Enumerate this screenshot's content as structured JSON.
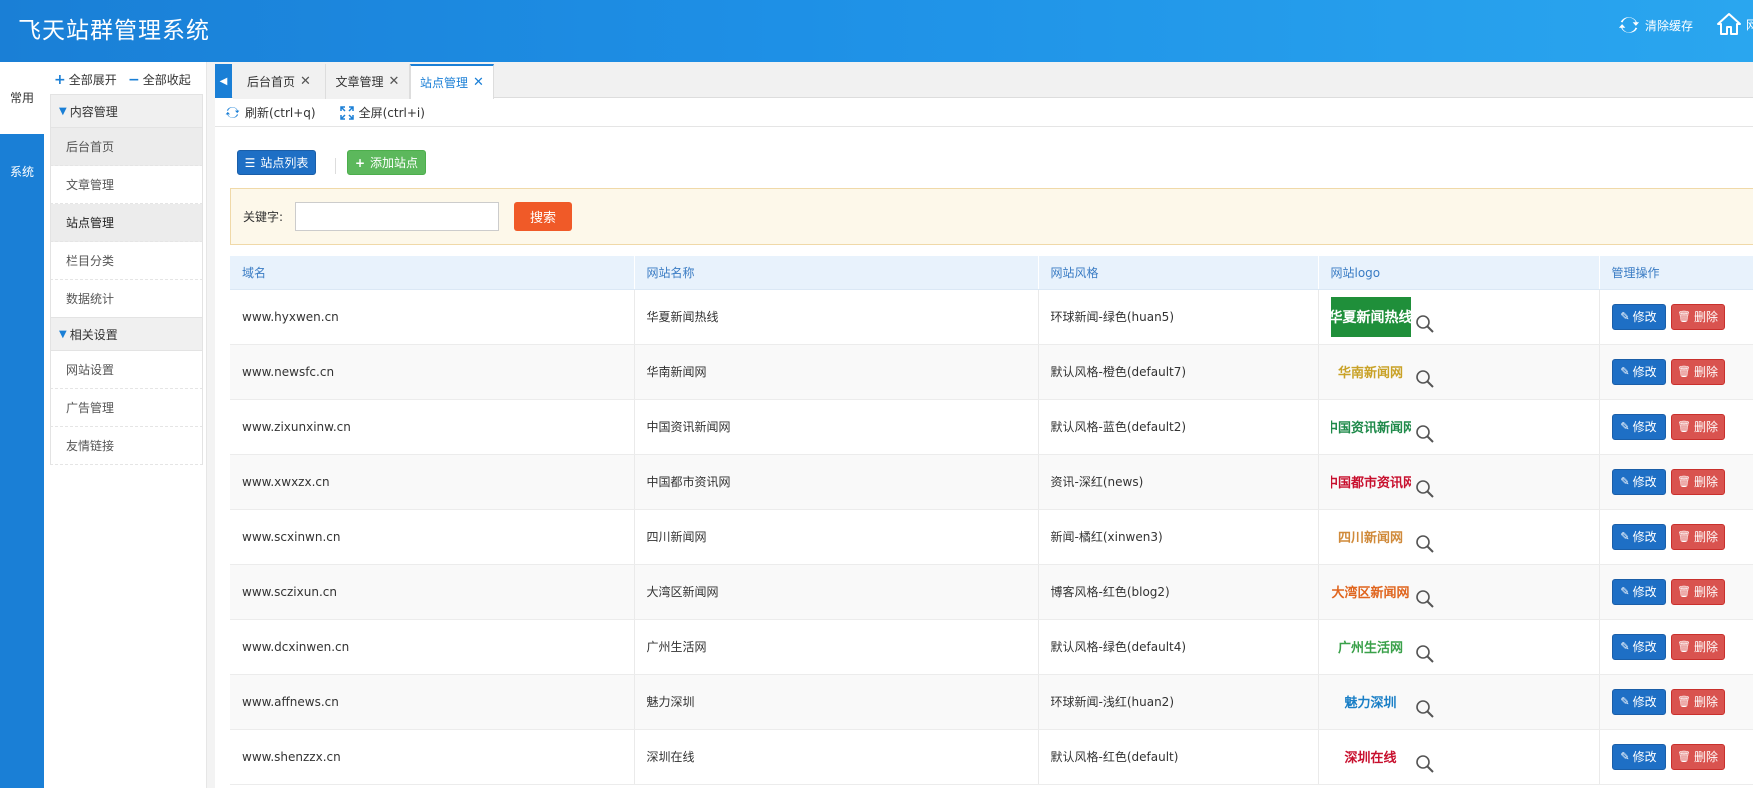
{
  "header": {
    "title": "飞天站群管理系统",
    "clear_cache": "清除缓存",
    "home_partial": "网"
  },
  "rail": {
    "tabs": [
      "常用",
      "系统"
    ]
  },
  "sidebar": {
    "expand_all": "全部展开",
    "collapse_all": "全部收起",
    "groups": [
      {
        "title": "内容管理",
        "items": [
          "后台首页",
          "文章管理",
          "站点管理",
          "栏目分类",
          "数据统计"
        ]
      },
      {
        "title": "相关设置",
        "items": [
          "网站设置",
          "广告管理",
          "友情链接"
        ]
      }
    ]
  },
  "tabs": [
    {
      "label": "后台首页"
    },
    {
      "label": "文章管理"
    },
    {
      "label": "站点管理"
    }
  ],
  "toolbar": {
    "refresh": "刷新(ctrl+q)",
    "fullscreen": "全屏(ctrl+i)"
  },
  "actions": {
    "site_list": "站点列表",
    "add_site": "添加站点"
  },
  "search": {
    "label": "关键字:",
    "value": "",
    "placeholder": "",
    "button": "搜索"
  },
  "table": {
    "columns": [
      "域名",
      "网站名称",
      "网站风格",
      "网站logo",
      "管理操作"
    ],
    "edit_label": "修改",
    "delete_label": "删除",
    "rows": [
      {
        "domain": "www.hyxwen.cn",
        "name": "华夏新闻热线",
        "style": "环球新闻-绿色(huan5)",
        "logo_text": "华夏新闻热线",
        "logo_color": "#ffffff"
      },
      {
        "domain": "www.newsfc.cn",
        "name": "华南新闻网",
        "style": "默认风格-橙色(default7)",
        "logo_text": "华南新闻网",
        "logo_color": "#c9a227"
      },
      {
        "domain": "www.zixunxinw.cn",
        "name": "中国资讯新闻网",
        "style": "默认风格-蓝色(default2)",
        "logo_text": "中国资讯新闻网",
        "logo_color": "#1f8a4a"
      },
      {
        "domain": "www.xwxzx.cn",
        "name": "中国都市资讯网",
        "style": "资讯-深红(news)",
        "logo_text": "中国都市资讯网",
        "logo_color": "#c8102e"
      },
      {
        "domain": "www.scxinwn.cn",
        "name": "四川新闻网",
        "style": "新闻-橘红(xinwen3)",
        "logo_text": "四川新闻网",
        "logo_color": "#d08a3a"
      },
      {
        "domain": "www.sczixun.cn",
        "name": "大湾区新闻网",
        "style": "博客风格-红色(blog2)",
        "logo_text": "大湾区新闻网",
        "logo_color": "#e0651e"
      },
      {
        "domain": "www.dcxinwen.cn",
        "name": "广州生活网",
        "style": "默认风格-绿色(default4)",
        "logo_text": "广州生活网",
        "logo_color": "#3aa14a"
      },
      {
        "domain": "www.affnews.cn",
        "name": "魅力深圳",
        "style": "环球新闻-浅红(huan2)",
        "logo_text": "魅力深圳",
        "logo_color": "#1a7fc6"
      },
      {
        "domain": "www.shenzzx.cn",
        "name": "深圳在线",
        "style": "默认风格-红色(default)",
        "logo_text": "深圳在线",
        "logo_color": "#c8102e"
      }
    ]
  }
}
